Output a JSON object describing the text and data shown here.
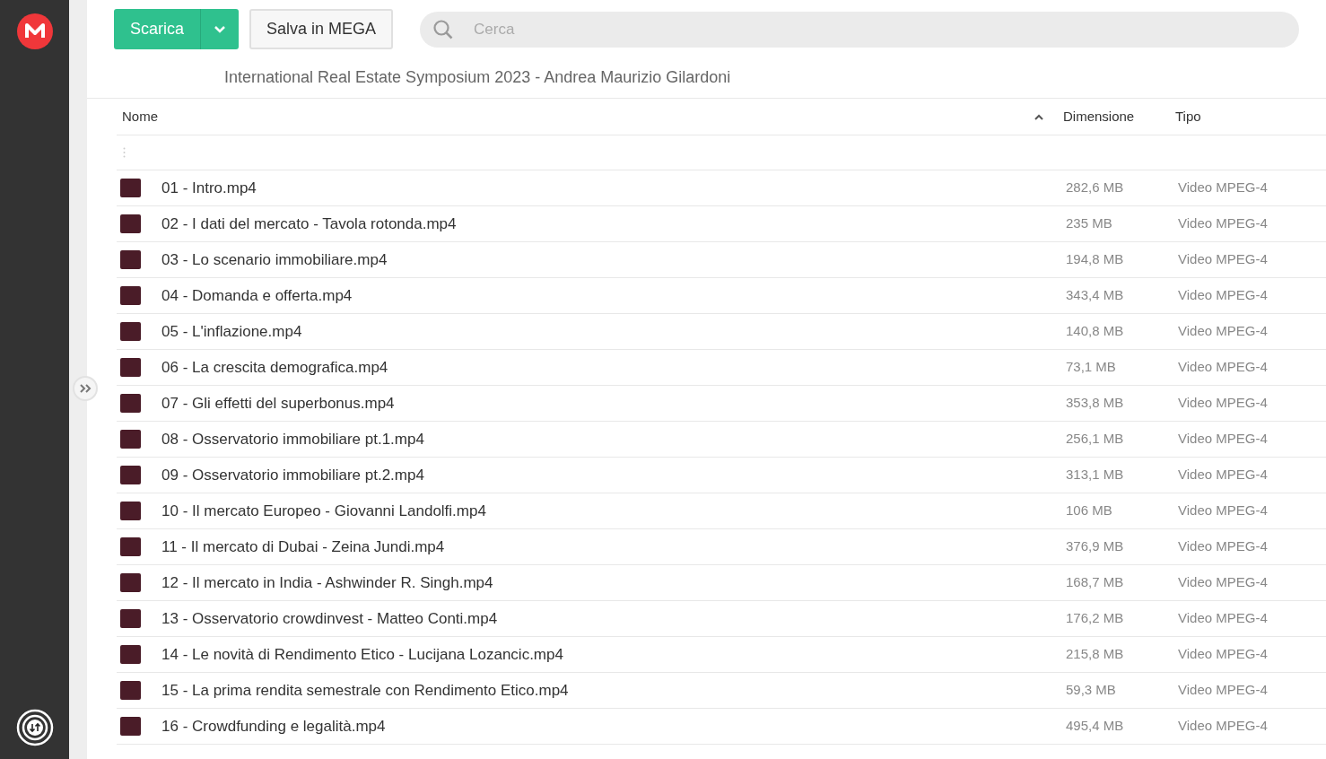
{
  "toolbar": {
    "download_button": "Scarica",
    "save_button": "Salva in MEGA",
    "search": {
      "placeholder": "Cerca"
    }
  },
  "folder_title": "International Real Estate Symposium 2023 - Andrea Maurizio Gilardoni",
  "table": {
    "columns": [
      {
        "label": "Nome",
        "sorted": true
      },
      {
        "label": "Dimensione",
        "sorted": false
      },
      {
        "label": "Tipo",
        "sorted": false
      }
    ],
    "rows": [
      {
        "name": "01 - Intro.mp4",
        "size": "282,6 MB",
        "type": "Video MPEG-4"
      },
      {
        "name": "02 - I dati del mercato - Tavola rotonda.mp4",
        "size": "235 MB",
        "type": "Video MPEG-4"
      },
      {
        "name": "03 - Lo scenario immobiliare.mp4",
        "size": "194,8 MB",
        "type": "Video MPEG-4"
      },
      {
        "name": "04 - Domanda e offerta.mp4",
        "size": "343,4 MB",
        "type": "Video MPEG-4"
      },
      {
        "name": "05 - L'inflazione.mp4",
        "size": "140,8 MB",
        "type": "Video MPEG-4"
      },
      {
        "name": "06 - La crescita demografica.mp4",
        "size": "73,1 MB",
        "type": "Video MPEG-4"
      },
      {
        "name": "07 - Gli effetti del superbonus.mp4",
        "size": "353,8 MB",
        "type": "Video MPEG-4"
      },
      {
        "name": "08 - Osservatorio immobiliare pt.1.mp4",
        "size": "256,1 MB",
        "type": "Video MPEG-4"
      },
      {
        "name": "09 - Osservatorio immobiliare pt.2.mp4",
        "size": "313,1 MB",
        "type": "Video MPEG-4"
      },
      {
        "name": "10 - Il mercato Europeo - Giovanni Landolfi.mp4",
        "size": "106 MB",
        "type": "Video MPEG-4"
      },
      {
        "name": "11 - Il mercato di Dubai - Zeina Jundi.mp4",
        "size": "376,9 MB",
        "type": "Video MPEG-4"
      },
      {
        "name": "12 - Il mercato in India - Ashwinder R. Singh.mp4",
        "size": "168,7 MB",
        "type": "Video MPEG-4"
      },
      {
        "name": "13 - Osservatorio crowdinvest - Matteo Conti.mp4",
        "size": "176,2 MB",
        "type": "Video MPEG-4"
      },
      {
        "name": "14 - Le novità di Rendimento Etico - Lucijana Lozancic.mp4",
        "size": "215,8 MB",
        "type": "Video MPEG-4"
      },
      {
        "name": "15 - La prima rendita semestrale con Rendimento Etico.mp4",
        "size": "59,3 MB",
        "type": "Video MPEG-4"
      },
      {
        "name": "16 - Crowdfunding e legalità.mp4",
        "size": "495,4 MB",
        "type": "Video MPEG-4"
      }
    ]
  }
}
